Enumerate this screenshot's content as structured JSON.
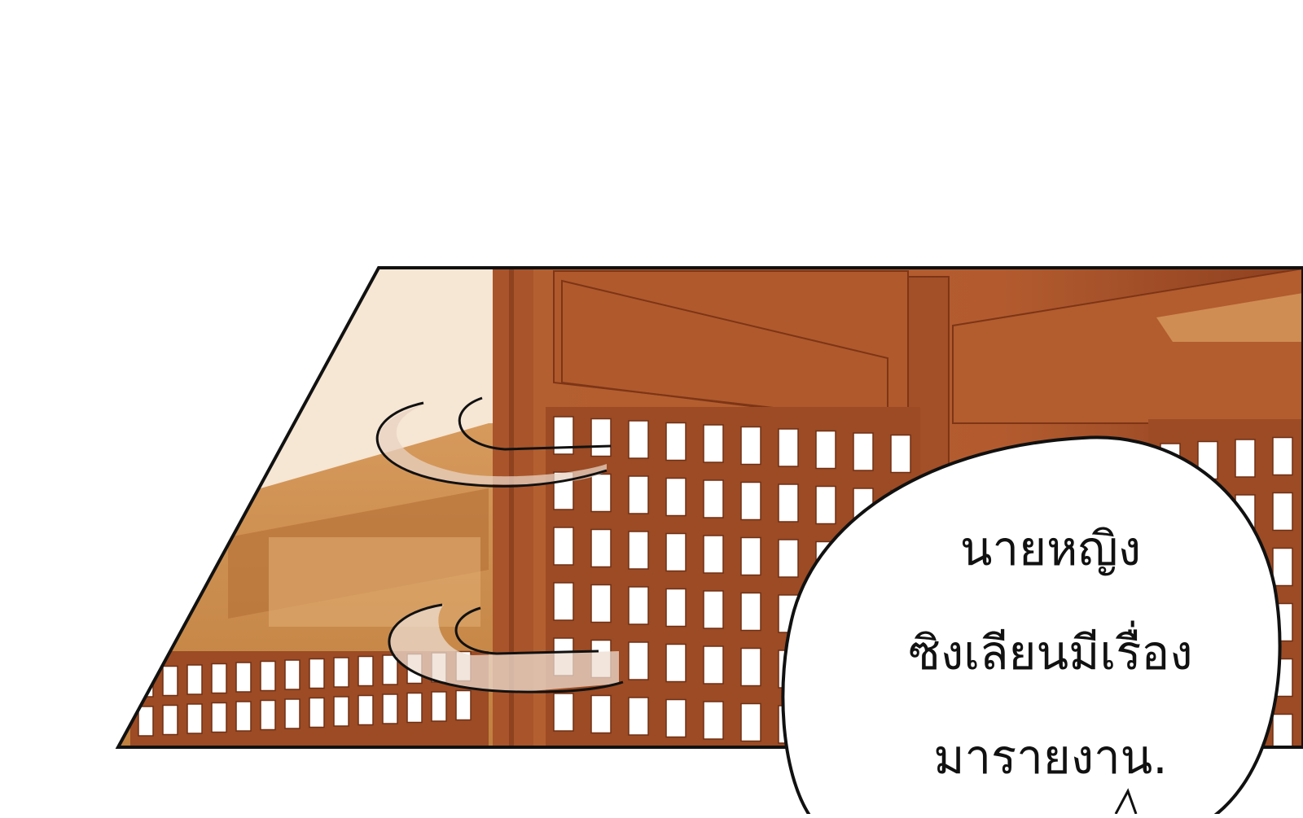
{
  "scene": {
    "panel_description_free": true,
    "colors": {
      "background": "#ffffff",
      "wood_dark": "#a9542a",
      "wood_mid": "#c57a45",
      "wood_light": "#d9a066",
      "wall_light": "#f6e6d4",
      "outline": "#111111"
    },
    "icons": [
      "swoosh-motion-icon",
      "swoosh-motion-icon"
    ]
  },
  "speech_bubble": {
    "lines": [
      "นายหญิง",
      "ซิงเลียนมีเรื่อง",
      "มารายงาน."
    ]
  }
}
